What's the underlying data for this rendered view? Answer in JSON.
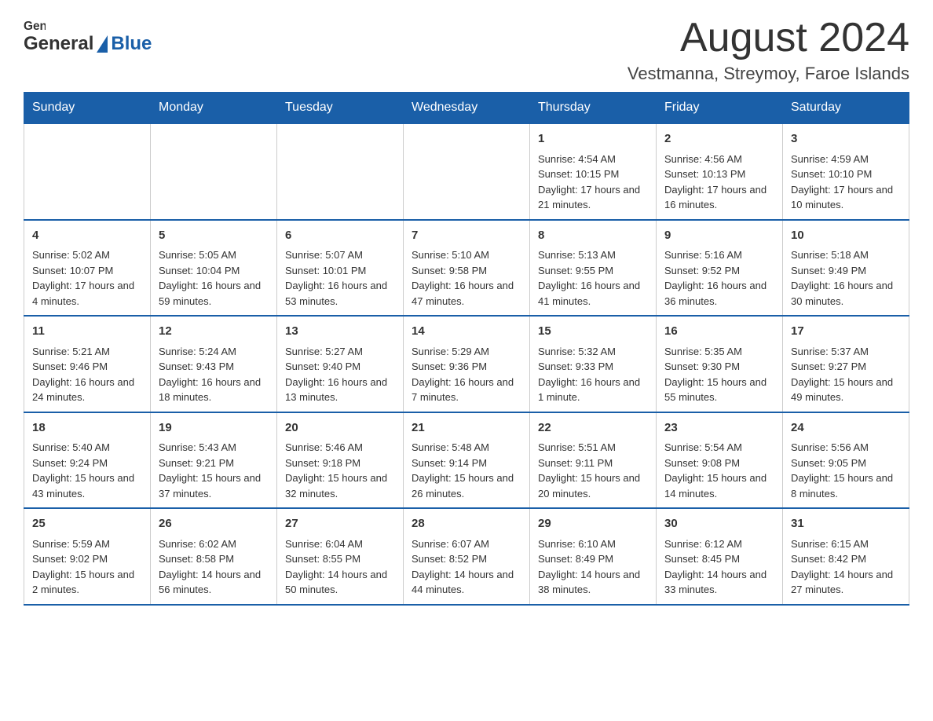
{
  "header": {
    "logo_general": "General",
    "logo_blue": "Blue",
    "month_title": "August 2024",
    "location": "Vestmanna, Streymoy, Faroe Islands"
  },
  "weekdays": [
    "Sunday",
    "Monday",
    "Tuesday",
    "Wednesday",
    "Thursday",
    "Friday",
    "Saturday"
  ],
  "weeks": [
    {
      "days": [
        {
          "number": "",
          "info": ""
        },
        {
          "number": "",
          "info": ""
        },
        {
          "number": "",
          "info": ""
        },
        {
          "number": "",
          "info": ""
        },
        {
          "number": "1",
          "info": "Sunrise: 4:54 AM\nSunset: 10:15 PM\nDaylight: 17 hours and 21 minutes."
        },
        {
          "number": "2",
          "info": "Sunrise: 4:56 AM\nSunset: 10:13 PM\nDaylight: 17 hours and 16 minutes."
        },
        {
          "number": "3",
          "info": "Sunrise: 4:59 AM\nSunset: 10:10 PM\nDaylight: 17 hours and 10 minutes."
        }
      ]
    },
    {
      "days": [
        {
          "number": "4",
          "info": "Sunrise: 5:02 AM\nSunset: 10:07 PM\nDaylight: 17 hours and 4 minutes."
        },
        {
          "number": "5",
          "info": "Sunrise: 5:05 AM\nSunset: 10:04 PM\nDaylight: 16 hours and 59 minutes."
        },
        {
          "number": "6",
          "info": "Sunrise: 5:07 AM\nSunset: 10:01 PM\nDaylight: 16 hours and 53 minutes."
        },
        {
          "number": "7",
          "info": "Sunrise: 5:10 AM\nSunset: 9:58 PM\nDaylight: 16 hours and 47 minutes."
        },
        {
          "number": "8",
          "info": "Sunrise: 5:13 AM\nSunset: 9:55 PM\nDaylight: 16 hours and 41 minutes."
        },
        {
          "number": "9",
          "info": "Sunrise: 5:16 AM\nSunset: 9:52 PM\nDaylight: 16 hours and 36 minutes."
        },
        {
          "number": "10",
          "info": "Sunrise: 5:18 AM\nSunset: 9:49 PM\nDaylight: 16 hours and 30 minutes."
        }
      ]
    },
    {
      "days": [
        {
          "number": "11",
          "info": "Sunrise: 5:21 AM\nSunset: 9:46 PM\nDaylight: 16 hours and 24 minutes."
        },
        {
          "number": "12",
          "info": "Sunrise: 5:24 AM\nSunset: 9:43 PM\nDaylight: 16 hours and 18 minutes."
        },
        {
          "number": "13",
          "info": "Sunrise: 5:27 AM\nSunset: 9:40 PM\nDaylight: 16 hours and 13 minutes."
        },
        {
          "number": "14",
          "info": "Sunrise: 5:29 AM\nSunset: 9:36 PM\nDaylight: 16 hours and 7 minutes."
        },
        {
          "number": "15",
          "info": "Sunrise: 5:32 AM\nSunset: 9:33 PM\nDaylight: 16 hours and 1 minute."
        },
        {
          "number": "16",
          "info": "Sunrise: 5:35 AM\nSunset: 9:30 PM\nDaylight: 15 hours and 55 minutes."
        },
        {
          "number": "17",
          "info": "Sunrise: 5:37 AM\nSunset: 9:27 PM\nDaylight: 15 hours and 49 minutes."
        }
      ]
    },
    {
      "days": [
        {
          "number": "18",
          "info": "Sunrise: 5:40 AM\nSunset: 9:24 PM\nDaylight: 15 hours and 43 minutes."
        },
        {
          "number": "19",
          "info": "Sunrise: 5:43 AM\nSunset: 9:21 PM\nDaylight: 15 hours and 37 minutes."
        },
        {
          "number": "20",
          "info": "Sunrise: 5:46 AM\nSunset: 9:18 PM\nDaylight: 15 hours and 32 minutes."
        },
        {
          "number": "21",
          "info": "Sunrise: 5:48 AM\nSunset: 9:14 PM\nDaylight: 15 hours and 26 minutes."
        },
        {
          "number": "22",
          "info": "Sunrise: 5:51 AM\nSunset: 9:11 PM\nDaylight: 15 hours and 20 minutes."
        },
        {
          "number": "23",
          "info": "Sunrise: 5:54 AM\nSunset: 9:08 PM\nDaylight: 15 hours and 14 minutes."
        },
        {
          "number": "24",
          "info": "Sunrise: 5:56 AM\nSunset: 9:05 PM\nDaylight: 15 hours and 8 minutes."
        }
      ]
    },
    {
      "days": [
        {
          "number": "25",
          "info": "Sunrise: 5:59 AM\nSunset: 9:02 PM\nDaylight: 15 hours and 2 minutes."
        },
        {
          "number": "26",
          "info": "Sunrise: 6:02 AM\nSunset: 8:58 PM\nDaylight: 14 hours and 56 minutes."
        },
        {
          "number": "27",
          "info": "Sunrise: 6:04 AM\nSunset: 8:55 PM\nDaylight: 14 hours and 50 minutes."
        },
        {
          "number": "28",
          "info": "Sunrise: 6:07 AM\nSunset: 8:52 PM\nDaylight: 14 hours and 44 minutes."
        },
        {
          "number": "29",
          "info": "Sunrise: 6:10 AM\nSunset: 8:49 PM\nDaylight: 14 hours and 38 minutes."
        },
        {
          "number": "30",
          "info": "Sunrise: 6:12 AM\nSunset: 8:45 PM\nDaylight: 14 hours and 33 minutes."
        },
        {
          "number": "31",
          "info": "Sunrise: 6:15 AM\nSunset: 8:42 PM\nDaylight: 14 hours and 27 minutes."
        }
      ]
    }
  ]
}
